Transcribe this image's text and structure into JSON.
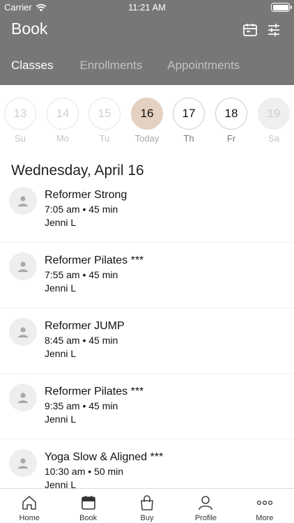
{
  "status_bar": {
    "carrier": "Carrier",
    "time": "11:21 AM"
  },
  "header": {
    "title": "Book",
    "tabs": [
      {
        "label": "Classes",
        "active": true
      },
      {
        "label": "Enrollments",
        "active": false
      },
      {
        "label": "Appointments",
        "active": false
      }
    ]
  },
  "days": [
    {
      "num": "13",
      "label": "Su",
      "state": "past"
    },
    {
      "num": "14",
      "label": "Mo",
      "state": "past"
    },
    {
      "num": "15",
      "label": "Tu",
      "state": "past"
    },
    {
      "num": "16",
      "label": "Today",
      "state": "today"
    },
    {
      "num": "17",
      "label": "Th",
      "state": "future"
    },
    {
      "num": "18",
      "label": "Fr",
      "state": "future"
    },
    {
      "num": "19",
      "label": "Sa",
      "state": "unavailable"
    }
  ],
  "date_heading": "Wednesday, April 16",
  "classes": [
    {
      "name": "Reformer Strong",
      "meta": "7:05 am • 45 min",
      "instructor": "Jenni L"
    },
    {
      "name": "Reformer Pilates ***",
      "meta": "7:55 am • 45 min",
      "instructor": "Jenni L"
    },
    {
      "name": "Reformer JUMP",
      "meta": "8:45 am • 45 min",
      "instructor": "Jenni L"
    },
    {
      "name": "Reformer Pilates ***",
      "meta": "9:35 am • 45 min",
      "instructor": "Jenni L"
    },
    {
      "name": "Yoga Slow & Aligned ***",
      "meta": "10:30 am • 50 min",
      "instructor": "Jenni L"
    }
  ],
  "bottom_nav": [
    {
      "label": "Home",
      "icon": "home-icon"
    },
    {
      "label": "Book",
      "icon": "calendar-icon",
      "active": true
    },
    {
      "label": "Buy",
      "icon": "shopping-bag-icon"
    },
    {
      "label": "Profile",
      "icon": "person-icon"
    },
    {
      "label": "More",
      "icon": "more-icon"
    }
  ],
  "colors": {
    "header_bg": "#777777",
    "today_bg": "#e5d1c1"
  }
}
